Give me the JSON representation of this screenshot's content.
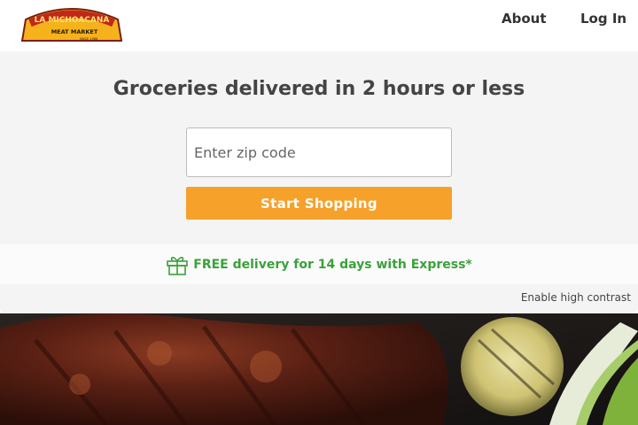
{
  "header": {
    "logo_text_top": "LA MICHOACANA",
    "logo_text_mid": "MEAT MARKET",
    "logo_text_small": "SINCE 1986",
    "nav": {
      "about": "About",
      "login": "Log In"
    }
  },
  "hero": {
    "title": "Groceries delivered in 2 hours or less",
    "zip_placeholder": "Enter zip code",
    "zip_value": "",
    "button_label": "Start Shopping"
  },
  "promo": {
    "text": "FREE delivery for 14 days with Express*",
    "icon": "gift-icon"
  },
  "accessibility": {
    "contrast_label": "Enable high contrast"
  },
  "colors": {
    "accent": "#f5a12a",
    "promo_green": "#3aa13a",
    "hero_bg": "#f4f4f4"
  }
}
